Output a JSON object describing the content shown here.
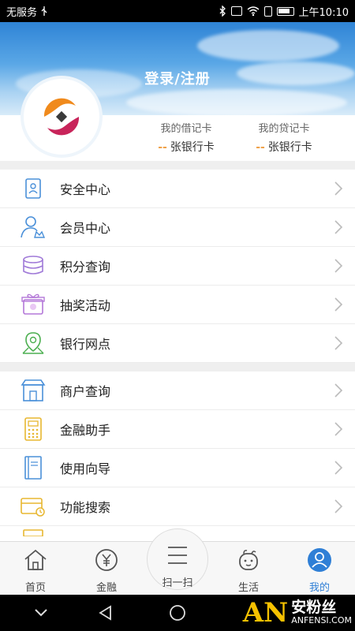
{
  "status_bar": {
    "carrier": "无服务",
    "time": "上午10:10"
  },
  "header": {
    "login_label": "登录/注册"
  },
  "cards": {
    "debit": {
      "title": "我的借记卡",
      "count": "--",
      "unit": "张银行卡"
    },
    "credit": {
      "title": "我的贷记卡",
      "count": "--",
      "unit": "张银行卡"
    }
  },
  "menu_group_1": [
    {
      "label": "安全中心",
      "icon": "security-icon"
    },
    {
      "label": "会员中心",
      "icon": "member-icon"
    },
    {
      "label": "积分查询",
      "icon": "points-icon"
    },
    {
      "label": "抽奖活动",
      "icon": "lottery-icon"
    },
    {
      "label": "银行网点",
      "icon": "location-icon"
    }
  ],
  "menu_group_2": [
    {
      "label": "商户查询",
      "icon": "store-icon"
    },
    {
      "label": "金融助手",
      "icon": "calculator-icon"
    },
    {
      "label": "使用向导",
      "icon": "guide-book-icon"
    },
    {
      "label": "功能搜索",
      "icon": "search-card-icon"
    }
  ],
  "tabs": [
    {
      "label": "首页",
      "icon": "home-icon"
    },
    {
      "label": "金融",
      "icon": "finance-icon"
    },
    {
      "label": "扫一扫",
      "icon": "scan-icon"
    },
    {
      "label": "生活",
      "icon": "life-icon"
    },
    {
      "label": "我的",
      "icon": "profile-icon",
      "active": true
    }
  ],
  "watermark": {
    "logo": "AN",
    "cn": "安粉丝",
    "en": "ANFENSI.COM"
  },
  "colors": {
    "accent": "#2f7fd6",
    "orange": "#f0a24b",
    "yellow": "#f5c100"
  }
}
